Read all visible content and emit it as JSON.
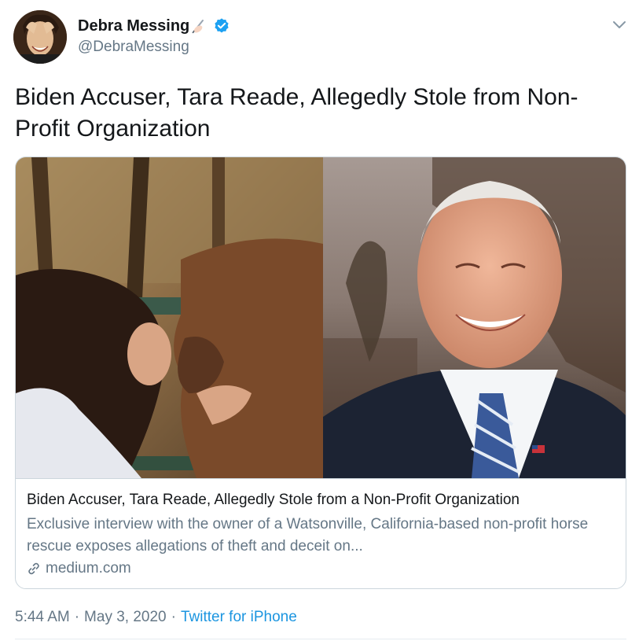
{
  "author": {
    "display_name": "Debra Messing",
    "handle": "@DebraMessing",
    "emoji_icon": "writing-hand-emoji",
    "verified_icon": "verified-badge-icon"
  },
  "tweet": {
    "text": "Biden Accuser, Tara Reade, Allegedly Stole from Non-Profit Organization"
  },
  "card": {
    "title": "Biden Accuser, Tara Reade, Allegedly Stole from a Non-Profit Organization",
    "description": "Exclusive interview with the owner of a Watsonville, California-based non-profit horse rescue exposes allegations of theft and deceit on...",
    "domain": "medium.com",
    "link_icon": "link-icon"
  },
  "meta": {
    "time": "5:44 AM",
    "separator": "·",
    "date": "May 3, 2020",
    "source": "Twitter for iPhone"
  },
  "colors": {
    "accent": "#1da1f2",
    "link": "#1b95e0",
    "muted": "#657786",
    "border": "#ccd6dd"
  }
}
